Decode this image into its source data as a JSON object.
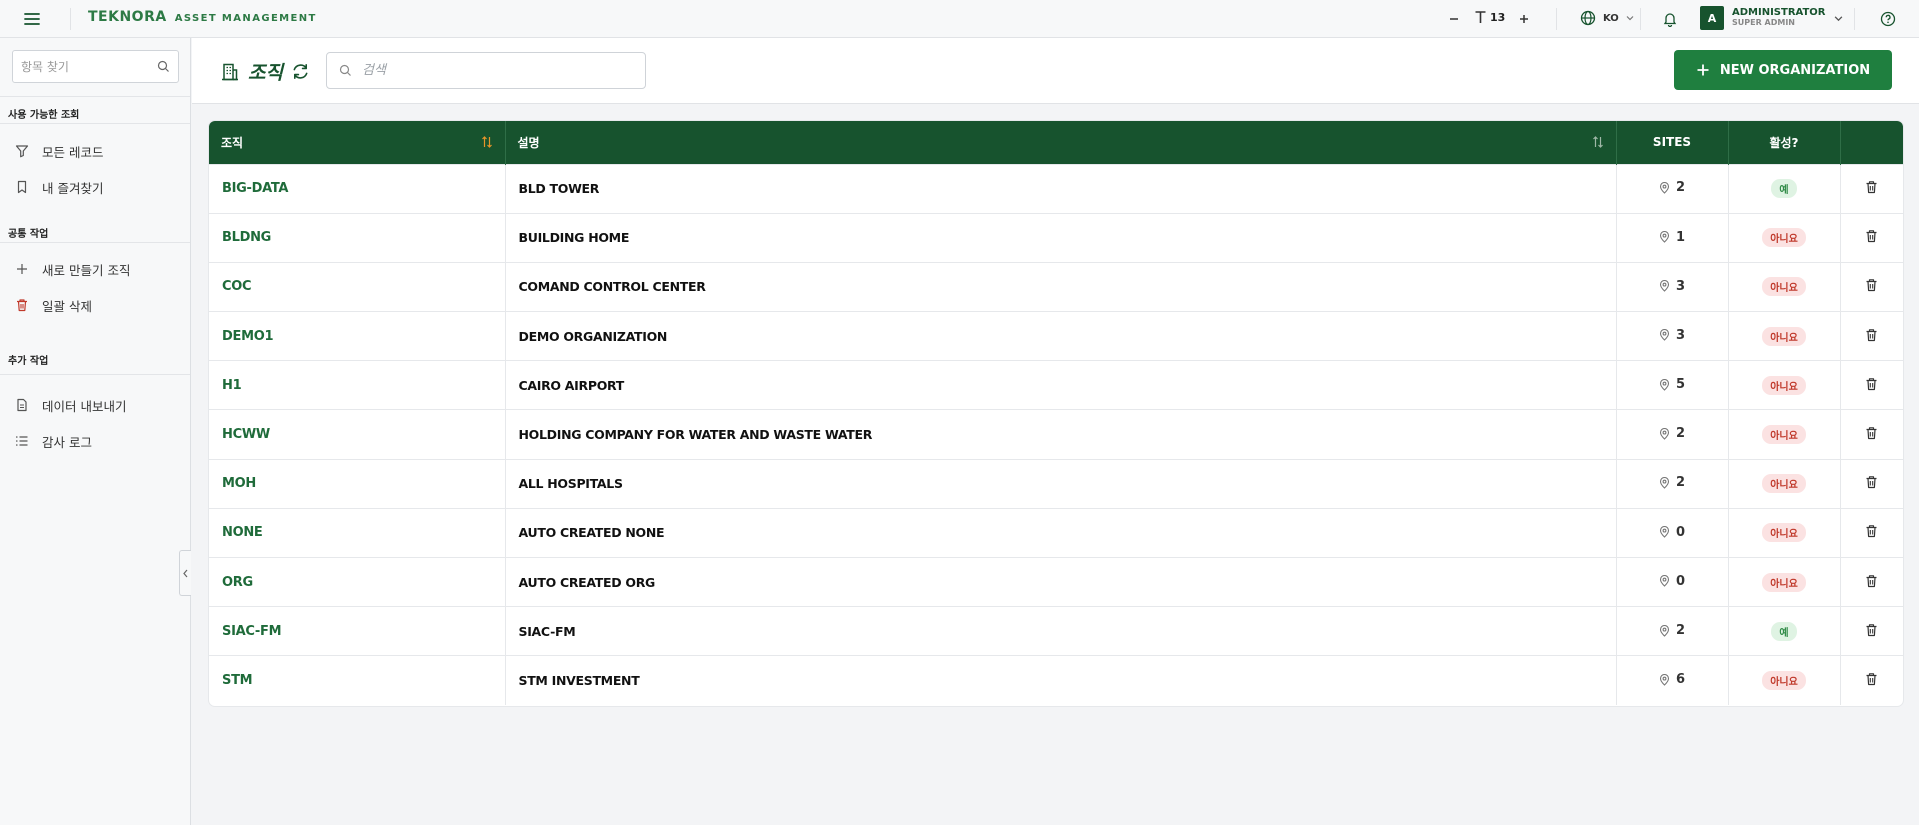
{
  "topbar": {
    "brand_name": "TEKNORA",
    "brand_sub": "ASSET MANAGEMENT",
    "font_size": "13",
    "language": "KO",
    "user_initial": "A",
    "user_name": "ADMINISTRATOR",
    "user_role": "SUPER ADMIN"
  },
  "sidebar": {
    "search_placeholder": "항목 찾기",
    "sections": [
      {
        "title": "사용 가능한 조회",
        "items": [
          {
            "label": "모든 레코드",
            "icon": "filter-icon"
          },
          {
            "label": "내 즐겨찾기",
            "icon": "bookmark-icon"
          }
        ]
      },
      {
        "title": "공통 작업",
        "items": [
          {
            "label": "새로 만들기 조직",
            "icon": "plus-icon"
          },
          {
            "label": "일괄 삭제",
            "icon": "trash-icon"
          }
        ]
      },
      {
        "title": "추가 작업",
        "items": [
          {
            "label": "데이터 내보내기",
            "icon": "file-icon"
          },
          {
            "label": "감사 로그",
            "icon": "list-icon"
          }
        ]
      }
    ]
  },
  "header": {
    "title": "조직",
    "search_placeholder": "검색",
    "new_button": "NEW ORGANIZATION"
  },
  "table": {
    "columns": [
      "조직",
      "설명",
      "SITES",
      "활성?"
    ],
    "rows": [
      {
        "code": "BIG-DATA",
        "desc": "BLD TOWER",
        "sites": "2",
        "active": "예",
        "is_active": true
      },
      {
        "code": "BLDNG",
        "desc": "BUILDING HOME",
        "sites": "1",
        "active": "아니요",
        "is_active": false
      },
      {
        "code": "COC",
        "desc": "COMAND CONTROL CENTER",
        "sites": "3",
        "active": "아니요",
        "is_active": false
      },
      {
        "code": "DEMO1",
        "desc": "DEMO ORGANIZATION",
        "sites": "3",
        "active": "아니요",
        "is_active": false
      },
      {
        "code": "H1",
        "desc": "CAIRO AIRPORT",
        "sites": "5",
        "active": "아니요",
        "is_active": false
      },
      {
        "code": "HCWW",
        "desc": "HOLDING COMPANY FOR WATER AND WASTE WATER",
        "sites": "2",
        "active": "아니요",
        "is_active": false
      },
      {
        "code": "MOH",
        "desc": "ALL HOSPITALS",
        "sites": "2",
        "active": "아니요",
        "is_active": false
      },
      {
        "code": "NONE",
        "desc": "AUTO CREATED NONE",
        "sites": "0",
        "active": "아니요",
        "is_active": false
      },
      {
        "code": "ORG",
        "desc": "AUTO CREATED ORG",
        "sites": "0",
        "active": "아니요",
        "is_active": false
      },
      {
        "code": "SIAC-FM",
        "desc": "SIAC-FM",
        "sites": "2",
        "active": "예",
        "is_active": true
      },
      {
        "code": "STM",
        "desc": "STM INVESTMENT",
        "sites": "6",
        "active": "아니요",
        "is_active": false
      }
    ]
  },
  "colors": {
    "brand_green": "#17532e",
    "button_green": "#1f7f3f",
    "sort_orange": "#e6952a",
    "danger_red": "#c0392b"
  }
}
